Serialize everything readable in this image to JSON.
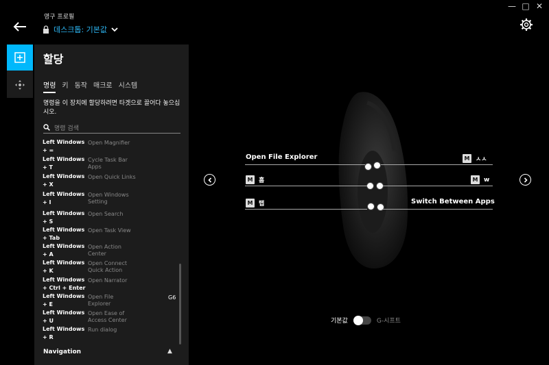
{
  "window": {
    "minimize": "—",
    "maximize": "□",
    "close": "✕"
  },
  "header": {
    "profile_caption": "영구 프로필",
    "profile_name": "데스크톱: 기본값"
  },
  "panel": {
    "title": "할당",
    "tabs": [
      {
        "label": "명령",
        "active": true
      },
      {
        "label": "키"
      },
      {
        "label": "동작"
      },
      {
        "label": "매크로"
      },
      {
        "label": "시스템"
      }
    ],
    "hint": "명령을 이 장치에 할당하려면 타겟으로 끌어다 놓으십시오.",
    "search_placeholder": "명령 검색",
    "commands": [
      {
        "key": "Left Windows + =",
        "desc": "Open Magnifier",
        "tag": ""
      },
      {
        "key": "Left Windows + T",
        "desc": "Cycle Task Bar Apps",
        "tag": ""
      },
      {
        "key": "Left Windows + X",
        "desc": "Open Quick Links",
        "tag": ""
      },
      {
        "key": "Left Windows + I",
        "desc": "Open Windows Setting",
        "tag": ""
      },
      {
        "key": "Left Windows + S",
        "desc": "Open Search",
        "tag": ""
      },
      {
        "key": "Left Windows + Tab",
        "desc": "Open Task View",
        "tag": ""
      },
      {
        "key": "Left Windows + A",
        "desc": "Open Action Center",
        "tag": ""
      },
      {
        "key": "Left Windows + K",
        "desc": "Open Connect Quick Action",
        "tag": ""
      },
      {
        "key": "Left Windows + Ctrl + Enter",
        "desc": "Open Narrator",
        "tag": ""
      },
      {
        "key": "Left Windows + E",
        "desc": "Open File Explorer",
        "tag": "G6"
      },
      {
        "key": "Left Windows + U",
        "desc": "Open Ease of Access Center",
        "tag": ""
      },
      {
        "key": "Left Windows + R",
        "desc": "Run dialog",
        "tag": ""
      }
    ],
    "section": "Navigation"
  },
  "assign": {
    "left": [
      {
        "label": "Open File Explorer"
      },
      {
        "label": "홈",
        "m": "M"
      },
      {
        "label": "탭",
        "m": "M"
      }
    ],
    "right": [
      {
        "label": "ㅅㅅ",
        "m": "M"
      },
      {
        "label": "w",
        "m": "M"
      },
      {
        "label": "Switch Between Apps"
      }
    ]
  },
  "footer": {
    "toggle_left": "기본값",
    "toggle_right": "G-시프트"
  },
  "icons": {
    "back": "arrow-left-icon",
    "lock": "lock-icon",
    "gear": "gear-icon",
    "add": "plus-square-icon",
    "move": "move-icon",
    "search": "search-icon",
    "prev": "chevron-left-circle-icon",
    "next": "chevron-right-circle-icon"
  },
  "colors": {
    "accent": "#00b8fc",
    "profile_text": "#2db7f5",
    "panel_bg": "#1c1c1c",
    "bg": "#000000"
  }
}
